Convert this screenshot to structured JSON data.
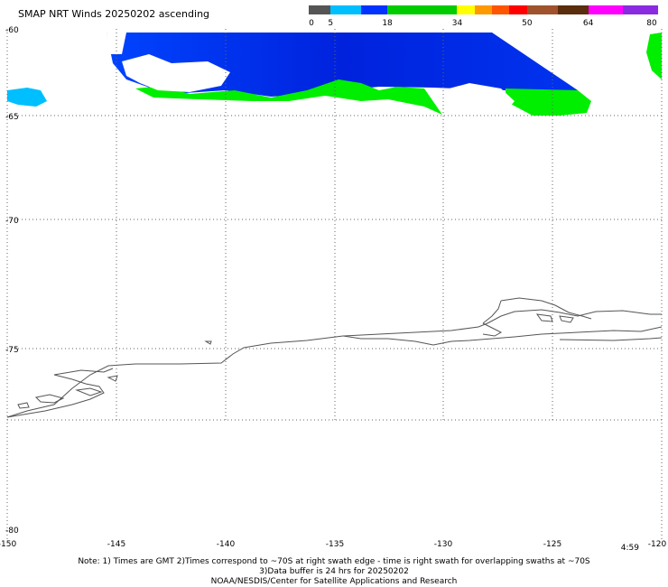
{
  "title": "SMAP NRT Winds 20250202 ascending",
  "colorbar": {
    "labels": [
      "0",
      "5",
      "18",
      "34",
      "50",
      "64",
      "80"
    ],
    "segments": [
      {
        "from": 0,
        "to": 5,
        "color": "#555555"
      },
      {
        "from": 5,
        "to": 12,
        "color": "#00bfff"
      },
      {
        "from": 12,
        "to": 18,
        "color": "#0033ff"
      },
      {
        "from": 18,
        "to": 34,
        "color": "#00cc00"
      },
      {
        "from": 34,
        "to": 38,
        "color": "#ffff00"
      },
      {
        "from": 38,
        "to": 42,
        "color": "#ff9900"
      },
      {
        "from": 42,
        "to": 46,
        "color": "#ff5500"
      },
      {
        "from": 46,
        "to": 50,
        "color": "#ff0000"
      },
      {
        "from": 50,
        "to": 57,
        "color": "#a0522d"
      },
      {
        "from": 57,
        "to": 64,
        "color": "#5a2d0c"
      },
      {
        "from": 64,
        "to": 72,
        "color": "#ff00ff"
      },
      {
        "from": 72,
        "to": 80,
        "color": "#8a2be2"
      }
    ]
  },
  "lat_labels": [
    "-60",
    "-65",
    "-70",
    "-75",
    "-80"
  ],
  "lon_labels": [
    "-150",
    "-145",
    "-140",
    "-135",
    "-130",
    "-125",
    "-120"
  ],
  "time_label": "4:59",
  "notes": {
    "line1": "Note: 1) Times are GMT 2)Times correspond to ~70S at right swath edge - time is right swath for overlapping swaths at ~70S",
    "line2": "3)Data buffer is 24 hrs for 20250202",
    "line3": "NOAA/NESDIS/Center for Satellite Applications and Research"
  },
  "colors": {
    "strong_blue": "#0033ee",
    "mid_blue": "#0066ff",
    "light_blue": "#00bfff",
    "green": "#00ee00",
    "coast": "#555555",
    "grid": "#666666"
  }
}
